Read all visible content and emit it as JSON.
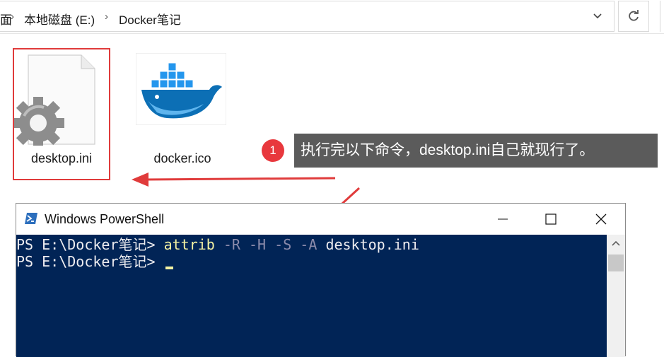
{
  "explorer": {
    "breadcrumbs": [
      "面",
      "本地磁盘 (E:)",
      "Docker笔记"
    ],
    "files": [
      {
        "name": "desktop.ini",
        "icon": "settings-file-icon"
      },
      {
        "name": "docker.ico",
        "icon": "docker-whale-icon"
      }
    ]
  },
  "annotation": {
    "step": "1",
    "text": "执行完以下命令，desktop.ini自己就现行了。"
  },
  "powershell": {
    "title": "Windows PowerShell",
    "line1": {
      "prompt": "PS E:\\Docker笔记> ",
      "command": "attrib",
      "p1": "-R",
      "p2": "-H",
      "p3": "-S",
      "p4": "-A",
      "arg": "desktop.ini"
    },
    "line2": {
      "prompt": "PS E:\\Docker笔记> "
    }
  },
  "colors": {
    "console_bg": "#012456",
    "command": "#f5f3a3",
    "parameter": "#8b8bab",
    "highlight": "#e03b3b",
    "callout_bg": "#5b5b5b"
  }
}
